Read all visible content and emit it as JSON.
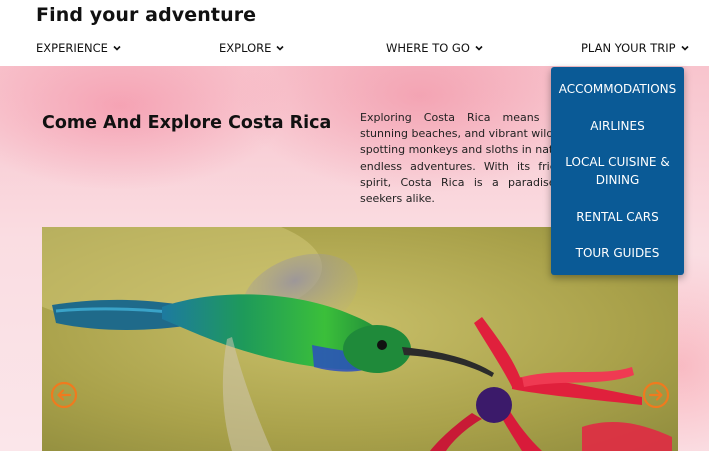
{
  "site": {
    "title": "Find your adventure"
  },
  "nav": {
    "items": [
      {
        "label": "EXPERIENCE"
      },
      {
        "label": "EXPLORE"
      },
      {
        "label": "WHERE TO GO"
      },
      {
        "label": "PLAN YOUR TRIP"
      }
    ],
    "icon": "chevron-down-icon"
  },
  "dropdown": {
    "parent": "PLAN YOUR TRIP",
    "items": [
      {
        "label": "ACCOMMODATIONS"
      },
      {
        "label": "AIRLINES"
      },
      {
        "label": "LOCAL CUISINE &",
        "label_line2": "DINING"
      },
      {
        "label": "RENTAL CARS"
      },
      {
        "label": "TOUR GUIDES"
      }
    ],
    "background": "#0a5a96"
  },
  "main": {
    "heading": "Come And Explore Costa Rica",
    "intro_lines": [
      "Exploring Costa Rica means disco",
      "stunning beaches, and vibrant wildlife.",
      "spotting monkeys and sloths in nationa",
      "endless adventures. With its friendly",
      "spirit, Costa Rica is a paradise for",
      "seekers alike."
    ]
  },
  "carousel": {
    "prev_icon": "arrow-left-circle-icon",
    "next_icon": "arrow-right-circle-icon",
    "arrow_color": "#f07a1e",
    "image": "hummingbird-photo"
  },
  "colors": {
    "accent": "#0a5a96",
    "hero_pink": "#f8c4cd",
    "arrow": "#f07a1e"
  }
}
